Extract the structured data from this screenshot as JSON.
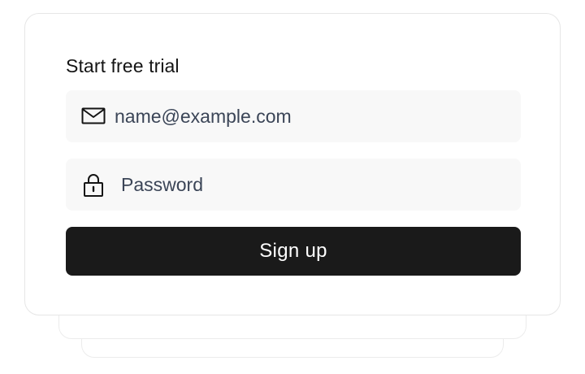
{
  "form": {
    "title": "Start free trial",
    "email": {
      "value": "",
      "placeholder": "name@example.com",
      "icon": "mail-icon"
    },
    "password": {
      "value": "",
      "placeholder": "Password",
      "icon": "lock-icon"
    },
    "submit_label": "Sign up"
  },
  "colors": {
    "button_background": "#1a1a1a",
    "button_text": "#ffffff",
    "field_background": "#f8f8f8",
    "placeholder_text": "#3b4557",
    "card_border": "#e6e6e6"
  }
}
